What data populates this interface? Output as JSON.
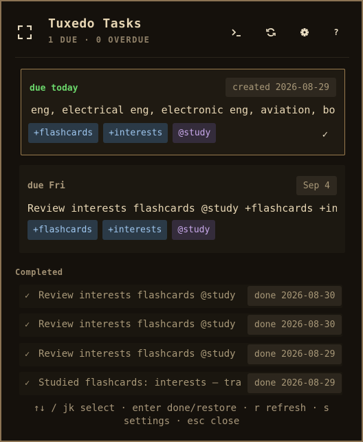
{
  "header": {
    "title": "Tuxedo Tasks",
    "subtitle": "1 DUE · 0 OVERDUE",
    "icons": [
      "focus-icon",
      "terminal-icon",
      "refresh-icon",
      "gear-icon",
      "help-icon"
    ],
    "help_label": "?"
  },
  "tasks": [
    {
      "due": "due today",
      "date_badge": "created 2026-08-29",
      "description": "eng, electrical eng, electronic eng, aviation, bo",
      "tags": [
        "+flashcards",
        "+interests",
        "@study"
      ],
      "selected": true,
      "check": "✓"
    },
    {
      "due": "due Fri",
      "date_badge": "Sep 4",
      "description": "Review interests flashcards @study +flashcards +in",
      "tags": [
        "+flashcards",
        "+interests",
        "@study"
      ]
    }
  ],
  "completed": {
    "label": "Completed",
    "items": [
      {
        "text": "Review interests flashcards @study +",
        "date": "done 2026-08-30"
      },
      {
        "text": "Review interests flashcards @study +",
        "date": "done 2026-08-30"
      },
      {
        "text": "Review interests flashcards @study +",
        "date": "done 2026-08-29"
      },
      {
        "text": "Studied flashcards: interests — tran",
        "date": "done 2026-08-29"
      }
    ],
    "check": "✓"
  },
  "footer": {
    "hint_line1": "↑↓ / jk select · enter done/restore · r refresh · s",
    "hint_line2": "settings · esc close"
  },
  "colors": {
    "accent_border": "#9a7b4e",
    "due_today": "#6bd66b",
    "project_tag": "#9ec6ee",
    "context_tag": "#c8a8ea"
  }
}
